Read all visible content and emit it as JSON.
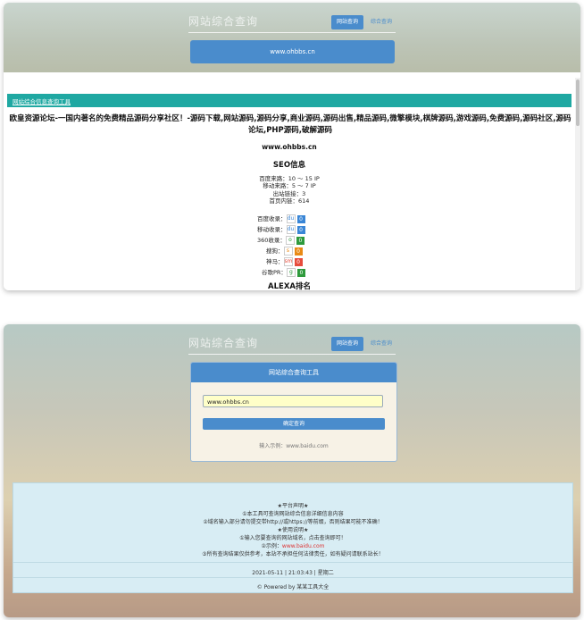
{
  "app": {
    "title": "网站综合查询",
    "tabs": [
      "网站查询",
      "综合查询"
    ],
    "domain_bar": "www.ohbbs.cn"
  },
  "result": {
    "tool_link": "网站综合信息查询工具",
    "description": "欧皇资源论坛-一国内著名的免费精品源码分享社区！-源码下载,网站源码,源码分享,商业源码,源码出售,精品源码,微擎模块,棋牌源码,游戏源码,免费源码,源码社区,源码论坛,PHP源码,破解源码",
    "domain": "www.ohbbs.cn",
    "seo_heading": "SEO信息",
    "seo_lines": [
      "百度来路：10 ～ 15 IP",
      "移动来路：5 ～ 7 IP",
      "出站链接：3",
      "首页内链：614"
    ],
    "indexes": [
      {
        "label": "百度收录：",
        "icon": "du",
        "value": "0",
        "color": "#3a86d6"
      },
      {
        "label": "移动收录：",
        "icon": "du",
        "value": "0",
        "color": "#3a86d6"
      },
      {
        "label": "360收录：",
        "icon": "o",
        "value": "0",
        "color": "#2e9a3c"
      },
      {
        "label": "搜狗：",
        "icon": "s",
        "value": "0",
        "color": "#e98a15"
      },
      {
        "label": "神马：",
        "icon": "sm",
        "value": "0",
        "color": "#e74c3c"
      },
      {
        "label": "谷歌PR：",
        "icon": "g",
        "value": "0",
        "color": "#2e9a3c"
      }
    ],
    "alexa_heading": "ALEXA排名"
  },
  "form": {
    "header": "网站综合查询工具",
    "input_value": "www.ohbbs.cn",
    "submit_label": "确定查询",
    "example": "输入示例：www.baidu.com"
  },
  "notice": {
    "lines": [
      "★平台声明★",
      "①本工具可查询网站综合信息详细信息内容",
      "②域名输入部分请勿提交带http://或https://等前缀，否则结果可能不准确！",
      "★使用说明★",
      "①输入您要查询的网站域名，点击查询即可！",
      "②示例：www.baidu.com",
      "③所有查询结果仅供参考，本站不承担任何法律责任，如有疑问请联系站长！"
    ],
    "example_link": "www.baidu.com",
    "datetime": "2021-05-11 | 21:03:43 | 星期二",
    "footer": "© Powered by 某某工具大全"
  }
}
